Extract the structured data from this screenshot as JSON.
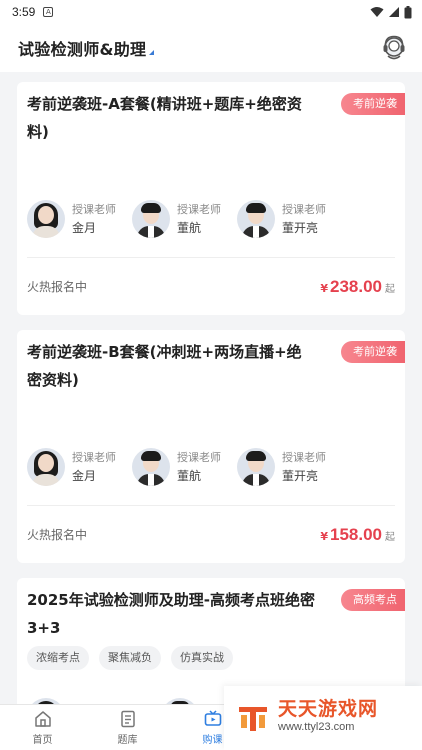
{
  "status_bar": {
    "time": "3:59",
    "notification_icon": "A"
  },
  "header": {
    "title": "试验检测师&助理"
  },
  "courses": [
    {
      "title": "考前逆袭班-A套餐(精讲班+题库+绝密资料)",
      "badge": "考前逆袭",
      "teachers": [
        {
          "role": "授课老师",
          "name": "金月"
        },
        {
          "role": "授课老师",
          "name": "董航"
        },
        {
          "role": "授课老师",
          "name": "董开亮"
        }
      ],
      "status": "火热报名中",
      "currency": "¥",
      "price": "238.00",
      "price_suffix": "起"
    },
    {
      "title": "考前逆袭班-B套餐(冲刺班+两场直播+绝密资料)",
      "badge": "考前逆袭",
      "teachers": [
        {
          "role": "授课老师",
          "name": "金月"
        },
        {
          "role": "授课老师",
          "name": "董航"
        },
        {
          "role": "授课老师",
          "name": "董开亮"
        }
      ],
      "status": "火热报名中",
      "currency": "¥",
      "price": "158.00",
      "price_suffix": "起"
    },
    {
      "title": "2025年试验检测师及助理-高频考点班绝密3+3",
      "badge": "高频考点",
      "tags": [
        "浓缩考点",
        "聚焦减负",
        "仿真实战"
      ]
    }
  ],
  "bottom_nav": [
    {
      "label": "首页",
      "icon": "home-icon"
    },
    {
      "label": "题库",
      "icon": "question-bank-icon"
    },
    {
      "label": "购课",
      "icon": "tv-icon",
      "active": true
    }
  ],
  "watermark": {
    "name": "天天游戏网",
    "url": "www.ttyl23.com"
  },
  "colors": {
    "accent_blue": "#2e7ee0",
    "price_red": "#e5414e",
    "badge_pink": "#f0646f",
    "watermark_orange": "#e8562a"
  }
}
